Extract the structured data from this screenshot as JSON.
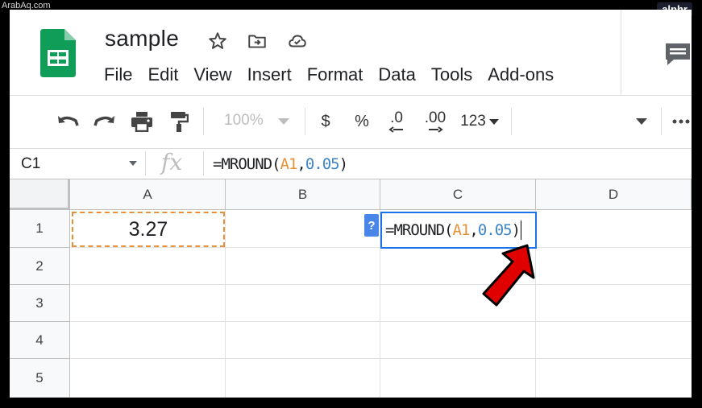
{
  "watermark_left": "ArabAq.com",
  "watermark_right": "alphr",
  "doc": {
    "title": "sample"
  },
  "menu": [
    "File",
    "Edit",
    "View",
    "Insert",
    "Format",
    "Data",
    "Tools",
    "Add-ons"
  ],
  "toolbar": {
    "zoom": "100%",
    "currency": "$",
    "percent": "%",
    "decrease_decimal": ".0",
    "increase_decimal": ".00",
    "more_formats": "123"
  },
  "formula_bar": {
    "name_box": "C1",
    "fx": "fx",
    "formula_prefix": "=MROUND(",
    "formula_ref": "A1",
    "formula_comma": ",",
    "formula_num": "0.05",
    "formula_close": ")"
  },
  "grid": {
    "columns": [
      "A",
      "B",
      "C",
      "D"
    ],
    "rows": [
      "1",
      "2",
      "3",
      "4",
      "5"
    ],
    "a1_value": "3.27",
    "help_badge": "?",
    "c1_prefix": "=MROUND(",
    "c1_ref": "A1",
    "c1_comma": ",",
    "c1_num": "0.05",
    "c1_close": ")"
  },
  "colors": {
    "sheets_green": "#0f9d58",
    "selection_blue": "#1a73e8",
    "ref_orange": "#e69138",
    "number_blue": "#3d85c6",
    "arrow_red": "#e00000"
  }
}
